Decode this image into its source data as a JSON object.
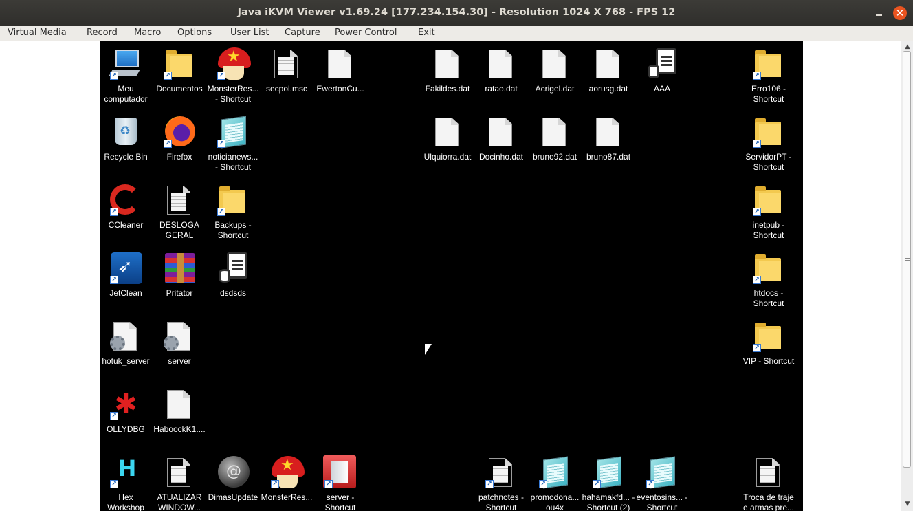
{
  "window": {
    "title": "Java iKVM Viewer v1.69.24 [177.234.154.30]  - Resolution 1024 X 768 - FPS 12",
    "close_glyph": "✕"
  },
  "menu": {
    "virtual_media": "Virtual Media",
    "record": "Record",
    "macro": "Macro",
    "options": "Options",
    "user_list": "User List",
    "capture": "Capture",
    "power_control": "Power Control",
    "exit": "Exit"
  },
  "desktop": {
    "icons": {
      "meu_computador": "Meu computador",
      "documentos": "Documentos",
      "monsterres_shortcut": "MonsterRes... - Shortcut",
      "secpol": "secpol.msc",
      "ewertoncu": "EwertonCu...",
      "fakildes": "Fakildes.dat",
      "ratao": "ratao.dat",
      "acrigel": "Acrigel.dat",
      "aorusg": "aorusg.dat",
      "aaa": "AAA",
      "erro106": "Erro106 - Shortcut",
      "recycle_bin": "Recycle Bin",
      "firefox": "Firefox",
      "noticianews": "noticianews... - Shortcut",
      "ulquiorra": "Ulquiorra.dat",
      "docinho": "Docinho.dat",
      "bruno92": "bruno92.dat",
      "bruno87": "bruno87.dat",
      "servidorpt": "ServidorPT - Shortcut",
      "ccleaner": "CCleaner",
      "desloga": "DESLOGA GERAL",
      "backups": "Backups - Shortcut",
      "inetpub": "inetpub - Shortcut",
      "jetclean": "JetClean",
      "pritator": "Pritator",
      "dsdsds": "dsdsds",
      "htdocs": "htdocs - Shortcut",
      "hotuk_server": "hotuk_server",
      "server": "server",
      "vip": "VIP - Shortcut",
      "ollydbg": "OLLYDBG",
      "haboock": "HaboockK1....",
      "hex_workshop": "Hex Workshop",
      "atualizar": "ATUALIZAR WINDOW...",
      "dimasupdate": "DimasUpdate",
      "monsterres2": "MonsterRes...",
      "server_shortcut": "server - Shortcut",
      "patchnotes": "patchnotes - Shortcut",
      "promodona": "promodona... ou4x",
      "hahamakfd": "hahamakfd... - Shortcut (2)",
      "eventosins": "eventosins... - Shortcut",
      "troca": "Troca de traje e armas pre..."
    },
    "dimas_glyph": "@",
    "hex_glyph": "H",
    "olly_glyph": "✱",
    "shortcut_glyph": "↗"
  }
}
